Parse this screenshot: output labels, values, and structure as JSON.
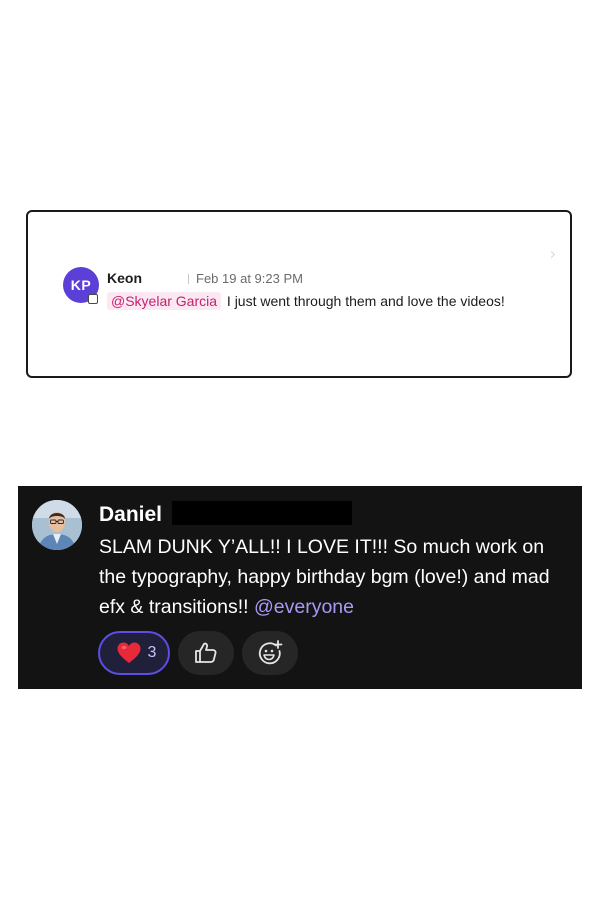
{
  "card1": {
    "avatar_initials": "KP",
    "author": "Keon",
    "timestamp": "Feb 19 at 9:23 PM",
    "mention": "@Skyelar Garcia",
    "message_text": " I just went through them and love the videos!"
  },
  "card2": {
    "author": "Daniel",
    "message_text": "SLAM DUNK Y’ALL!! I LOVE IT!!! So much work on the typography, happy birthday bgm (love!) and mad efx & transitions!! ",
    "mention": "@everyone",
    "reactions": [
      {
        "icon": "heart-icon",
        "count": "3",
        "selected": true
      },
      {
        "icon": "thumbs-up-icon",
        "count": "",
        "selected": false
      },
      {
        "icon": "add-emoji-icon",
        "count": "",
        "selected": false
      }
    ]
  },
  "colors": {
    "avatar_bg": "#5b3fd6",
    "mention_light": "#c1246d",
    "mention_light_bg": "#fce8f3",
    "dark_bg": "#131313",
    "mention_dark": "#a79af5",
    "reaction_border": "#5c4ee6",
    "heart": "#e8293a"
  }
}
